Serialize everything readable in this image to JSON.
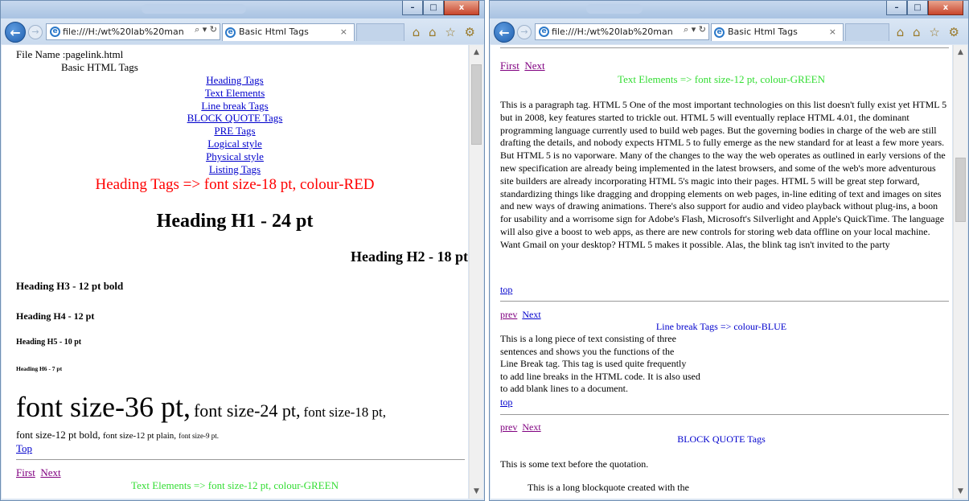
{
  "browser": {
    "address": "file:///H:/wt%20lab%20man",
    "address_controls": "⌕ ▾ ↻",
    "tab_title": "Basic Html Tags",
    "tab_close": "×",
    "back_icon": "back-arrow-icon",
    "toolbar_icons": "⌂ ⌂ ☆ ⚙",
    "window_buttons": [
      "–",
      "□",
      "x"
    ]
  },
  "left": {
    "file_name": "File Name :pagelink.html",
    "heading": "Basic HTML Tags",
    "nav_links": [
      "Heading Tags",
      "Text Elements",
      "Line break Tags",
      "BLOCK QUOTE Tags",
      "PRE Tags",
      "Logical style",
      "Physical style",
      "Listing Tags"
    ],
    "heading_tags_title": "Heading Tags => font size-18 pt, colour-RED",
    "h1": "Heading H1 - 24 pt",
    "h2": "Heading H2 - 18 pt",
    "h3": "Heading H3 - 12 pt bold",
    "h4": "Heading H4 - 12 pt",
    "h5": "Heading H5 - 10 pt",
    "h6": "Heading H6 - 7 pt",
    "font36": "font size-36 pt,",
    "font24": "font size-24 pt,",
    "font18": "font size-18 pt,",
    "font12b": "font size-12 pt bold,",
    "font12p": "font size-12 pt plain,",
    "font9": "font size-9 pt.",
    "top_link": "Top",
    "first_link": "First",
    "next_link": "Next",
    "text_elements_title": "Text Elements => font size-12 pt, colour-GREEN"
  },
  "right": {
    "first_link": "First",
    "next_link": "Next",
    "text_elements_title": "Text Elements => font size-12 pt, colour-GREEN",
    "paragraph": "This is a paragraph tag. HTML 5 One of the most important technologies on this list doesn't fully exist yet  HTML 5  but in 2008, key features started to trickle out. HTML 5 will eventually replace HTML 4.01, the dominant programming language currently used to build web pages. But the governing bodies in charge of the web are still drafting the details, and nobody expects HTML 5 to fully emerge as the new standard for at least a few more years. But HTML 5 is no vaporware. Many of the changes to the way the web operates as outlined in early versions of the new specification are already being implemented in the latest browsers, and some of the web's more adventurous site builders are already incorporating HTML 5's magic into their pages. HTML 5 will be great step forward, standardizing things like dragging and dropping elements on web pages, in-line editing of text and images on sites and new ways of drawing animations. There's also support for audio and video playback without plug-ins, a boon for usability and a worrisome sign for Adobe's Flash, Microsoft's Silverlight and Apple's QuickTime. The language will also give a boost to web apps, as there are new controls for storing web data offline on your local machine. Want Gmail on your desktop? HTML 5 makes it possible. Alas, the blink tag isn't invited to the party",
    "top_link": "top",
    "prev_link": "prev",
    "next_link2": "Next",
    "line_break_title": "Line break Tags => colour-BLUE",
    "line_break_lines": [
      "This is a long piece of text consisting of three",
      "sentences and shows you the functions of the",
      "Line Break tag. This tag is used quite frequently",
      "to add line breaks in the HTML code. It is also used",
      "to add blank lines to a document."
    ],
    "top_link2": "top",
    "prev_link2": "prev",
    "next_link3": "Next",
    "blockquote_title": "BLOCK QUOTE Tags",
    "before_quote": "This is some text before the quotation.",
    "blockquote_text": "This is a long blockquote created with the"
  },
  "colors": {
    "red": "#ff0000",
    "green": "#33dd33",
    "blue": "#0000cc",
    "visited": "#800080"
  }
}
